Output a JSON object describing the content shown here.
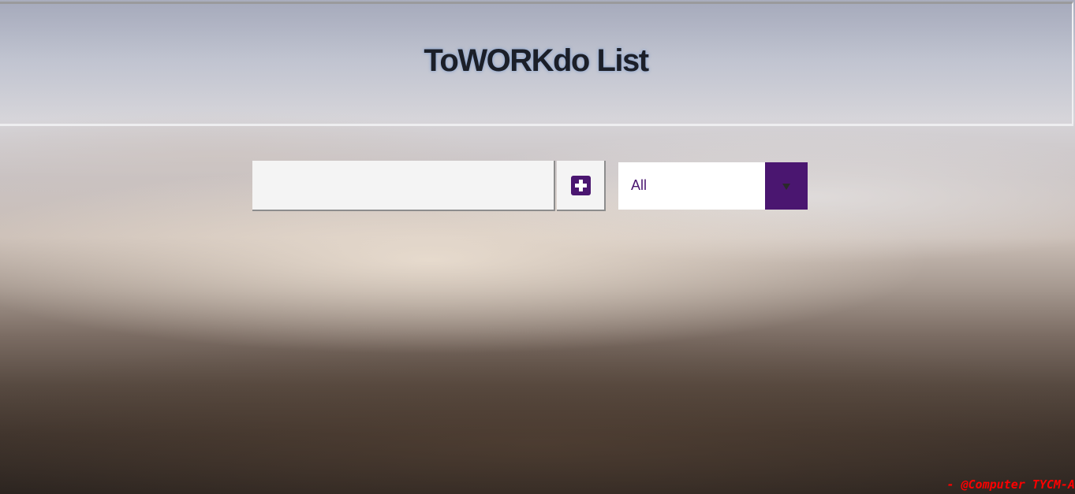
{
  "header": {
    "title": "ToWORKdo List"
  },
  "todo_form": {
    "input_value": "",
    "input_placeholder": "",
    "add_button_icon": "plus-square-icon"
  },
  "filter": {
    "selected": "All",
    "arrow_icon": "chevron-down-icon"
  },
  "footer": {
    "credit": "- @Computer TYCM-A"
  },
  "colors": {
    "accent": "#4a1670",
    "credit": "#ff0000"
  }
}
